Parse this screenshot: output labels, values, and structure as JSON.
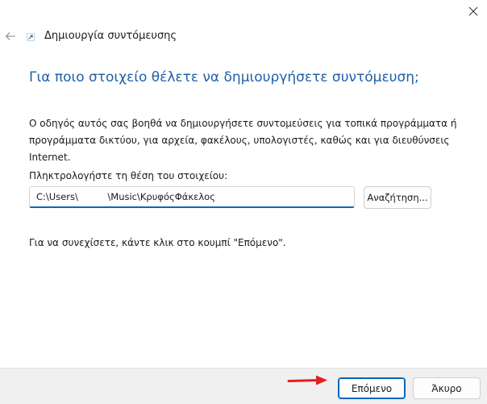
{
  "window": {
    "close_icon": "close-icon"
  },
  "header": {
    "back_icon": "back-arrow-icon",
    "wizard_icon": "shortcut-icon",
    "title": "Δημιουργία συντόμευσης"
  },
  "main": {
    "heading": "Για ποιο στοιχείο θέλετε να δημιουργήσετε συντόμευση;",
    "description": "Ο οδηγός αυτός σας βοηθά να δημιουργήσετε συντομεύσεις για τοπικά προγράμματα ή προγράμματα δικτύου, για αρχεία, φακέλους, υπολογιστές, καθώς και για διευθύνσεις Internet.",
    "location_label": "Πληκτρολογήστε τη θέση του στοιχείου:",
    "location_value": "C:\\Users\\          \\Music\\ΚρυφόςΦάκελος",
    "browse_label": "Αναζήτηση...",
    "continue_text": "Για να συνεχίσετε, κάντε κλικ στο κουμπί \"Επόμενο\"."
  },
  "footer": {
    "next_label": "Επόμενο",
    "cancel_label": "Άκυρο",
    "annotation_icon": "red-arrow-icon"
  },
  "colors": {
    "heading": "#1f5fa8",
    "accent": "#0067c0",
    "annotation": "#e02020",
    "footer_bg": "#f0f0f0"
  }
}
